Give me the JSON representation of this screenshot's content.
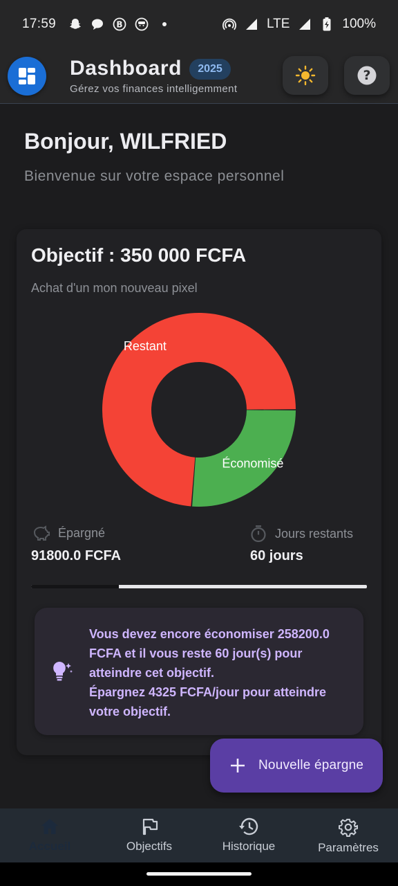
{
  "status_bar": {
    "time": "17:59",
    "network": "LTE",
    "battery": "100%"
  },
  "header": {
    "title": "Dashboard",
    "year_badge": "2025",
    "subtitle": "Gérez vos finances intelligemment",
    "theme_icon": "sun-icon",
    "help_icon": "help-icon"
  },
  "greeting": {
    "title": "Bonjour, WILFRIED",
    "subtitle": "Bienvenue sur votre espace personnel"
  },
  "goal": {
    "title": "Objectif : 350 000 FCFA",
    "description": "Achat d'un mon nouveau pixel",
    "stats": {
      "saved_label": "Épargné",
      "saved_value": "91800.0 FCFA",
      "days_label": "Jours restants",
      "days_value": "60 jours"
    },
    "progress_fraction": 0.262,
    "tip": {
      "line1": "Vous devez encore économiser 258200.0 FCFA et il vous reste 60 jour(s) pour atteindre cet objectif.",
      "line2": "Épargnez 4325 FCFA/jour pour atteindre votre objectif."
    }
  },
  "chart_data": {
    "type": "pie",
    "slices": [
      {
        "label": "Restant",
        "value": 258200,
        "color": "#f44336"
      },
      {
        "label": "Économisé",
        "value": 91800,
        "color": "#4caf50"
      }
    ]
  },
  "fab": {
    "label": "Nouvelle épargne"
  },
  "bottom_nav": {
    "items": [
      {
        "label": "Accueil",
        "icon": "home-icon"
      },
      {
        "label": "Objectifs",
        "icon": "flag-icon"
      },
      {
        "label": "Historique",
        "icon": "history-icon"
      },
      {
        "label": "Paramètres",
        "icon": "settings-icon"
      }
    ]
  }
}
